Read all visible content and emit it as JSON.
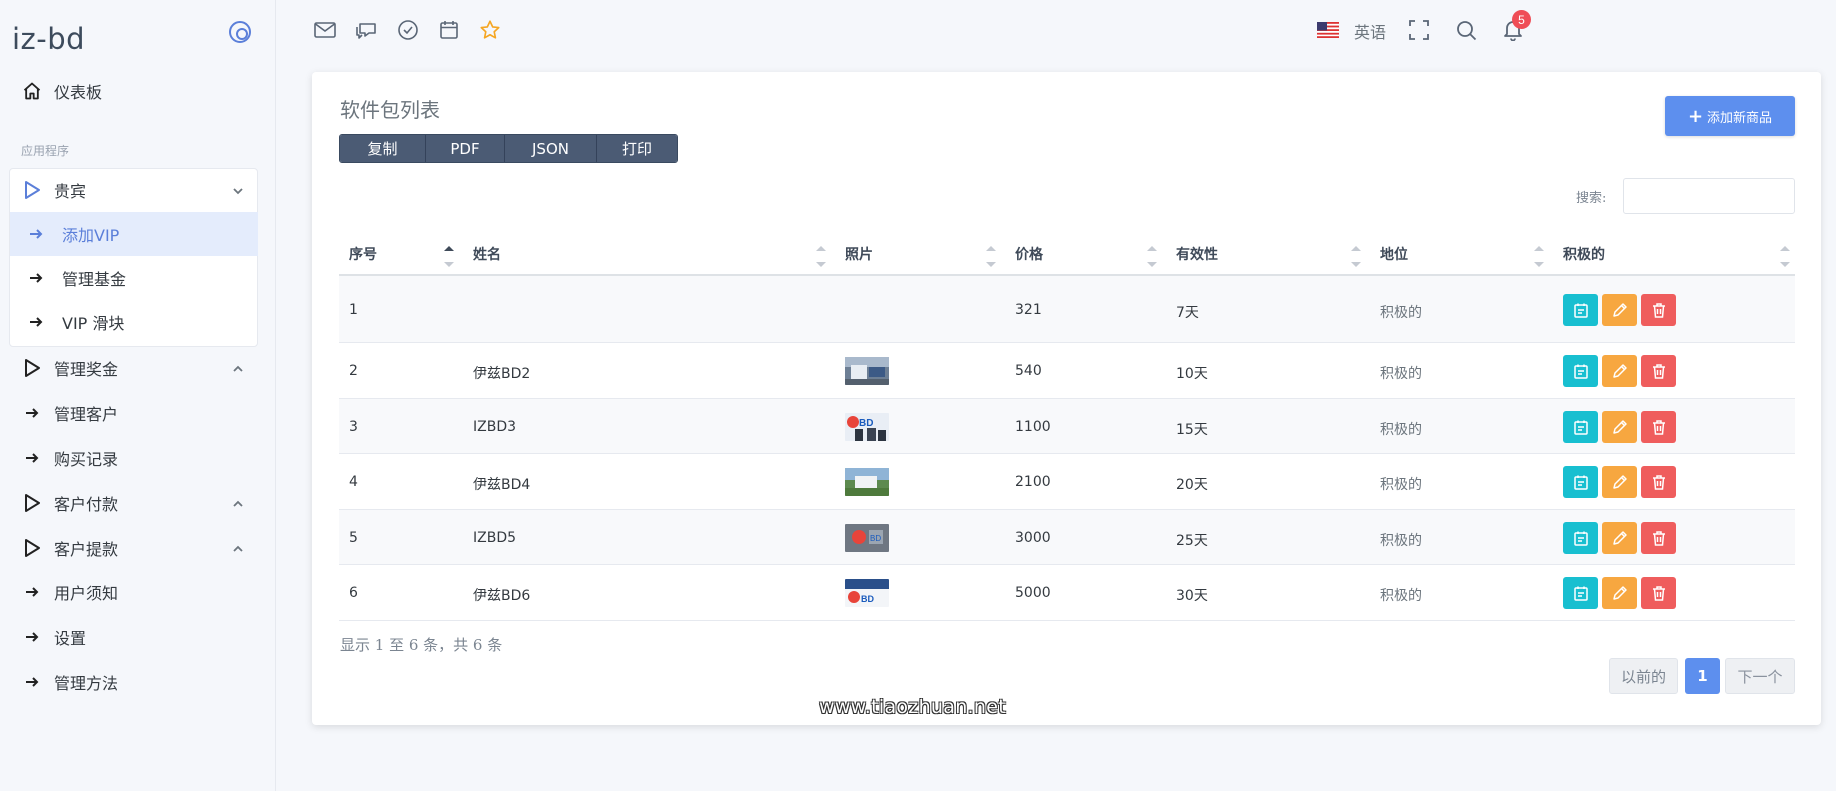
{
  "brand": {
    "name": "iz-bd"
  },
  "sidebar": {
    "dashboard": "仪表板",
    "section_label": "应用程序",
    "group": {
      "label": "贵宾",
      "items": [
        "添加VIP",
        "管理基金",
        "VIP 滑块"
      ]
    },
    "items": [
      {
        "label": "管理奖金",
        "icon": "play-outline-icon",
        "chevron": true
      },
      {
        "label": "管理客户",
        "icon": "arrow-right-icon",
        "chevron": false
      },
      {
        "label": "购买记录",
        "icon": "arrow-right-icon",
        "chevron": false
      },
      {
        "label": "客户付款",
        "icon": "play-outline-icon",
        "chevron": true
      },
      {
        "label": "客户提款",
        "icon": "play-outline-icon",
        "chevron": true
      },
      {
        "label": "用户须知",
        "icon": "arrow-right-icon",
        "chevron": false
      },
      {
        "label": "设置",
        "icon": "arrow-right-icon",
        "chevron": false
      },
      {
        "label": "管理方法",
        "icon": "arrow-right-icon",
        "chevron": false
      }
    ]
  },
  "topbar": {
    "language": "英语",
    "notification_count": "5"
  },
  "card": {
    "title": "软件包列表",
    "export_buttons": [
      "复制",
      "PDF",
      "JSON",
      "打印"
    ],
    "add_button": "添加新商品",
    "search_label": "搜索:",
    "search_value": ""
  },
  "table": {
    "columns": [
      "序号",
      "姓名",
      "照片",
      "价格",
      "有效性",
      "地位",
      "积极的"
    ],
    "rows": [
      {
        "id": "1",
        "name": "",
        "photo": false,
        "price": "321",
        "validity": "7天",
        "status": "积极的"
      },
      {
        "id": "2",
        "name": "伊兹BD2",
        "photo": true,
        "price": "540",
        "validity": "10天",
        "status": "积极的"
      },
      {
        "id": "3",
        "name": "IZBD3",
        "photo": true,
        "price": "1100",
        "validity": "15天",
        "status": "积极的"
      },
      {
        "id": "4",
        "name": "伊兹BD4",
        "photo": true,
        "price": "2100",
        "validity": "20天",
        "status": "积极的"
      },
      {
        "id": "5",
        "name": "IZBD5",
        "photo": true,
        "price": "3000",
        "validity": "25天",
        "status": "积极的"
      },
      {
        "id": "6",
        "name": "伊兹BD6",
        "photo": true,
        "price": "5000",
        "validity": "30天",
        "status": "积极的"
      }
    ]
  },
  "footer": {
    "info": "显示 1 至 6 条，共 6 条",
    "prev": "以前的",
    "current_page": "1",
    "next": "下一个"
  },
  "watermark": "www.tiaozhuan.net",
  "colors": {
    "primary": "#5d8fee",
    "info": "#18bfd0",
    "warning": "#f7a740",
    "danger": "#ef5d5d",
    "badge": "#ef4d56"
  }
}
